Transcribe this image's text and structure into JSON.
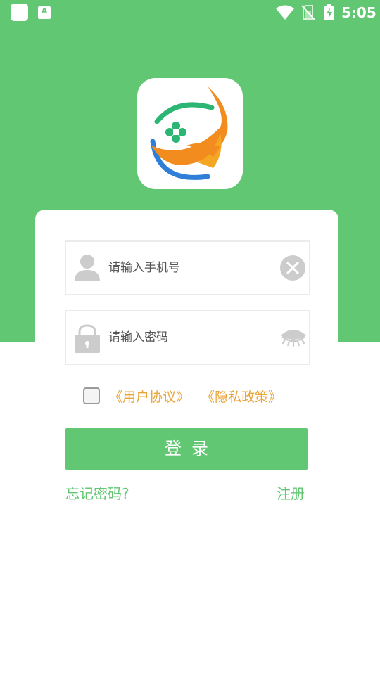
{
  "status_bar": {
    "time": "5:05",
    "icons": [
      "app-square-icon",
      "keyboard-a-icon",
      "wifi-icon",
      "no-sim-icon",
      "battery-charging-icon"
    ]
  },
  "logo": {
    "icon": "app-logo-icon"
  },
  "login_form": {
    "phone_field": {
      "placeholder": "请输入手机号",
      "value": "",
      "lead_icon": "user-icon",
      "trail_icon": "clear-icon"
    },
    "password_field": {
      "placeholder": "请输入密码",
      "value": "",
      "lead_icon": "lock-icon",
      "trail_icon": "eye-closed-icon"
    },
    "agreement": {
      "checked": false,
      "user_agreement": "《用户协议》",
      "privacy_policy": "《隐私政策》"
    },
    "login_button": "登录",
    "forgot_password": "忘记密码?",
    "register": "注册"
  },
  "colors": {
    "primary_green": "#62c772",
    "link_orange": "#e9a43a",
    "field_border": "#ebebeb",
    "icon_gray": "#cccccc"
  }
}
